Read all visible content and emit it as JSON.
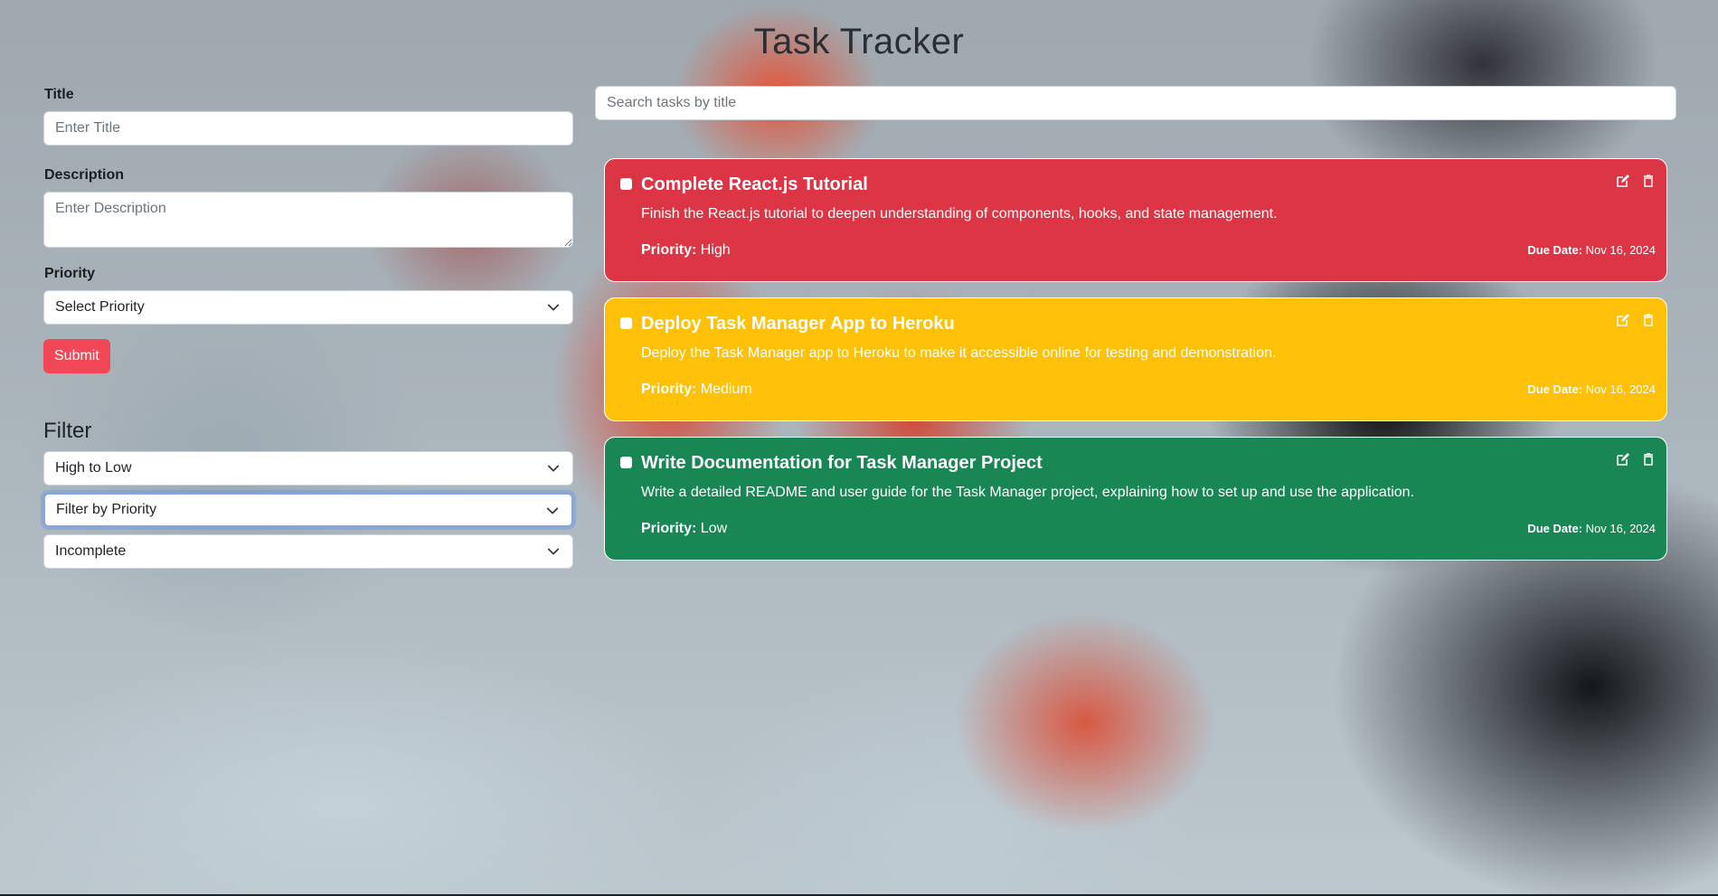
{
  "app": {
    "title": "Task Tracker"
  },
  "form": {
    "title_label": "Title",
    "title_placeholder": "Enter Title",
    "description_label": "Description",
    "description_placeholder": "Enter Description",
    "priority_label": "Priority",
    "priority_selected": "Select Priority",
    "submit_label": "Submit",
    "submit_color": "#f14757"
  },
  "filter": {
    "heading": "Filter",
    "sort_selected": "High to Low",
    "priority_selected": "Filter by Priority",
    "status_selected": "Incomplete"
  },
  "search": {
    "placeholder": "Search tasks by title"
  },
  "labels": {
    "priority": "Priority:",
    "due_date": "Due Date:"
  },
  "tasks": [
    {
      "title": "Complete React.js Tutorial",
      "description": "Finish the React.js tutorial to deepen understanding of components, hooks, and state management.",
      "priority": "High",
      "due_date": "Nov 16, 2024",
      "color": "#dc3545",
      "completed": false
    },
    {
      "title": "Deploy Task Manager App to Heroku",
      "description": "Deploy the Task Manager app to Heroku to make it accessible online for testing and demonstration.",
      "priority": "Medium",
      "due_date": "Nov 16, 2024",
      "color": "#ffc107",
      "completed": false
    },
    {
      "title": "Write Documentation for Task Manager Project",
      "description": "Write a detailed README and user guide for the Task Manager project, explaining how to set up and use the application.",
      "priority": "Low",
      "due_date": "Nov 16, 2024",
      "color": "#198754",
      "completed": false
    }
  ],
  "icons": {
    "select_arrow": "chevron-down-icon",
    "edit": "edit-icon",
    "delete": "trash-icon",
    "checkbox": "checkbox-icon"
  }
}
